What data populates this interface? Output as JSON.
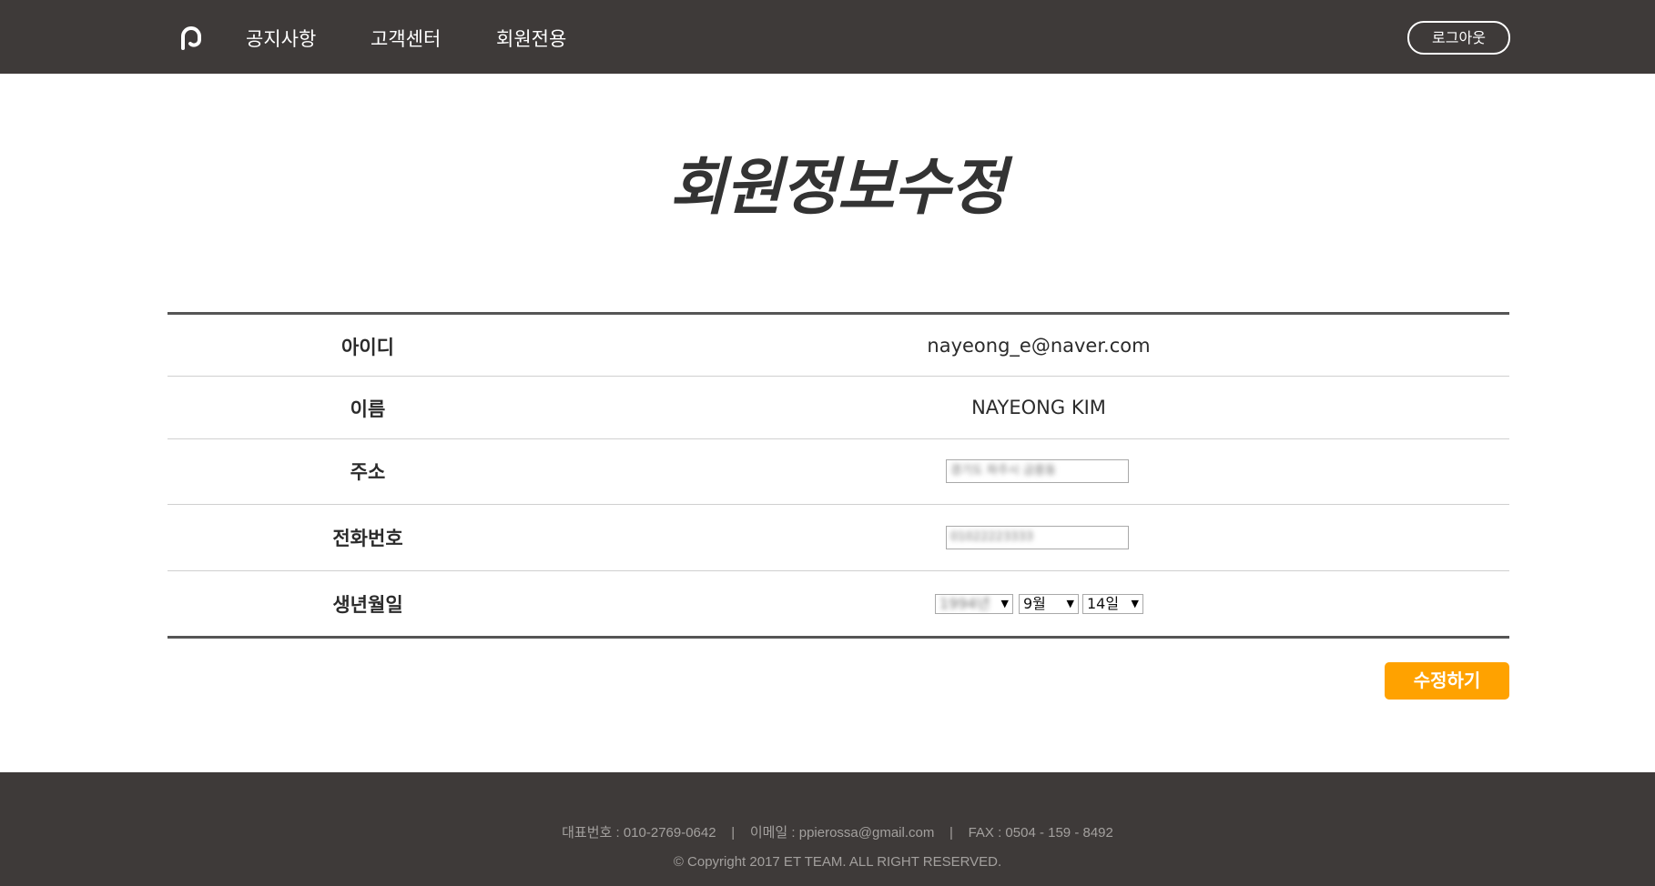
{
  "header": {
    "logo_icon": "brand-logo-icon",
    "nav": [
      "공지사항",
      "고객센터",
      "회원전용"
    ],
    "logout_label": "로그아웃"
  },
  "page": {
    "title": "회원정보수정"
  },
  "form": {
    "rows": [
      {
        "label": "아이디",
        "value": "nayeong_e@naver.com"
      },
      {
        "label": "이름",
        "value": "NAYEONG KIM"
      },
      {
        "label": "주소",
        "value": "경기도 파주시 금릉동"
      },
      {
        "label": "전화번호",
        "value": "01022223333"
      },
      {
        "label": "생년월일"
      }
    ],
    "birth": {
      "year": "1994년",
      "month": "9월",
      "day": "14일"
    },
    "submit_label": "수정하기"
  },
  "footer": {
    "contact": "대표번호 : 010-2769-0642    |    이메일 : ppierossa@gmail.com    |    FAX : 0504 - 159 - 8492",
    "copyright": "© Copyright 2017 ET TEAM. ALL RIGHT RESERVED."
  },
  "colors": {
    "header_bg": "#3e3a39",
    "accent": "#ffa200"
  }
}
